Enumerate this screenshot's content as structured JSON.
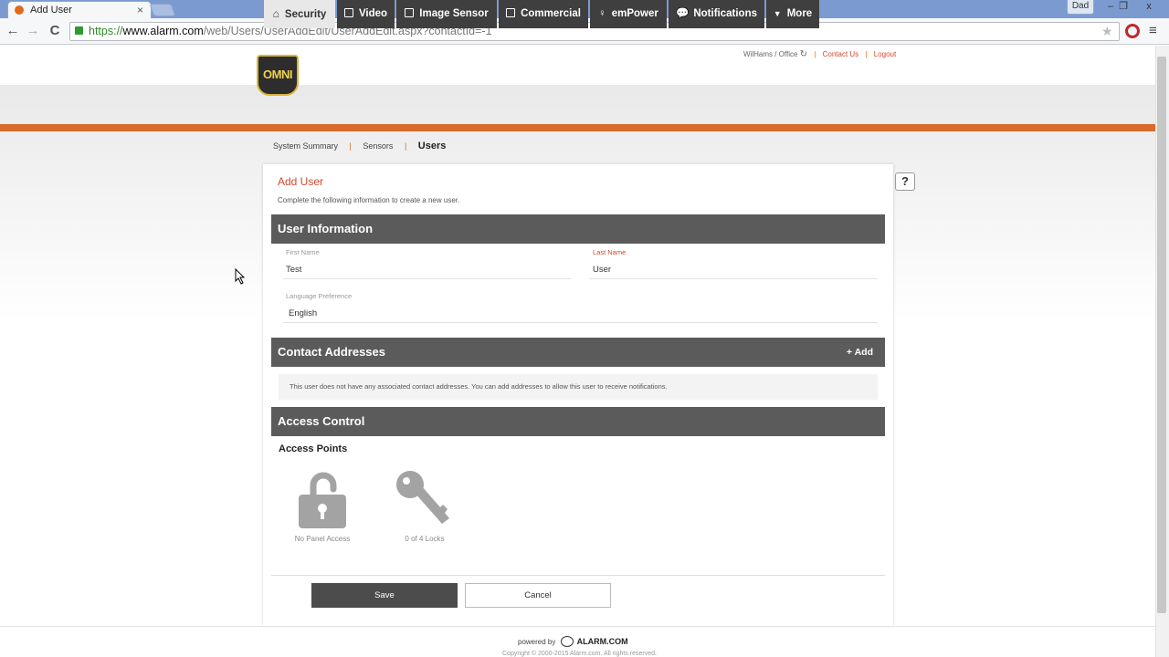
{
  "browser": {
    "tab_title": "Add User",
    "tab_close": "×",
    "user_name": "Dad",
    "window_buttons": [
      "–",
      "❐",
      "x"
    ],
    "url_scheme": "https://",
    "url_host": "www.alarm.com",
    "url_path": "/web/Users/UserAddEdit/UserAddEdit.aspx?contactId=-1",
    "back_icon": "←",
    "forward_icon": "→",
    "reload_icon": "C",
    "star_icon": "★",
    "menu_icon": "≡"
  },
  "header": {
    "logo_text": "OMNI",
    "account_label": "WilHams / Office",
    "refresh_icon": "↻",
    "contact_us": "Contact Us",
    "logout": "Logout"
  },
  "nav": {
    "items": [
      {
        "label": "Security",
        "active": true
      },
      {
        "label": "Video"
      },
      {
        "label": "Image Sensor"
      },
      {
        "label": "Commercial"
      },
      {
        "label": "emPower"
      },
      {
        "label": "Notifications"
      },
      {
        "label": "More"
      }
    ]
  },
  "subnav": {
    "items": [
      "System Summary",
      "Sensors",
      "Users"
    ],
    "current": "Users",
    "separator": "|"
  },
  "card": {
    "title": "Add User",
    "subtitle": "Complete the following information to create a new user.",
    "help_label": "?"
  },
  "user_info": {
    "heading": "User Information",
    "first_name_label": "First Name",
    "first_name_value": "Test",
    "last_name_label": "Last Name",
    "last_name_value": "User",
    "language_label": "Language Preference",
    "language_value": "English"
  },
  "contacts": {
    "heading": "Contact Addresses",
    "add_label": "+ Add",
    "empty_message": "This user does not have any associated contact addresses. You can add addresses to allow this user to receive notifications."
  },
  "access": {
    "heading": "Access Control",
    "points_title": "Access Points",
    "panel_label": "No Panel Access",
    "locks_label": "0 of 4 Locks"
  },
  "actions": {
    "save": "Save",
    "cancel": "Cancel"
  },
  "footer": {
    "powered_by": "powered by",
    "brand": "ALARM.COM",
    "copyright": "Copyright © 2000-2015 Alarm.com. All rights reserved."
  },
  "colors": {
    "accent_orange": "#d86a2c",
    "nav_dark": "#3f3f3f",
    "section_gray": "#5b5b5b",
    "link_red": "#d2482a"
  }
}
